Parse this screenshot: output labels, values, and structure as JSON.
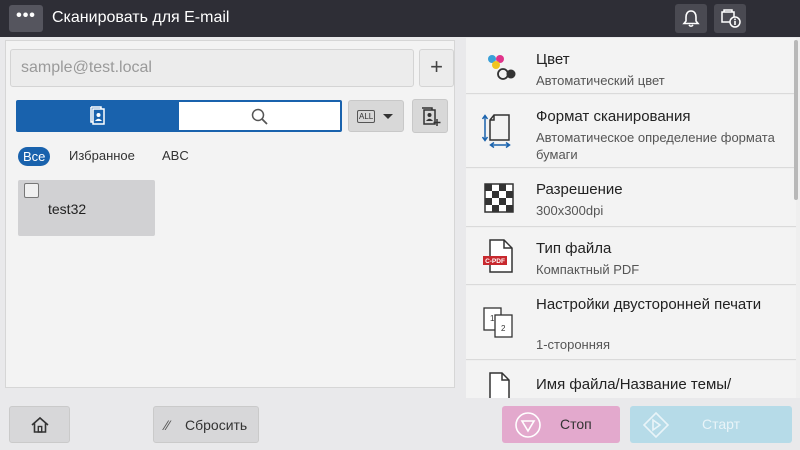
{
  "header": {
    "menu_label": "•••",
    "title": "Сканировать для E-mail",
    "icons": [
      "bell-icon",
      "info-status-icon"
    ]
  },
  "destination": {
    "email_placeholder": "sample@test.local",
    "add_label": "+"
  },
  "search_tabs": [
    "address-book-icon",
    "search-icon"
  ],
  "index_select": {
    "label": "ALL"
  },
  "filters": [
    "Все",
    "Избранное",
    "ABC"
  ],
  "active_filter": "Все",
  "address_entries": [
    {
      "name": "test32",
      "checked": false
    }
  ],
  "settings": [
    {
      "label": "Цвет",
      "value": "Автоматический цвет",
      "icon": "color-icon"
    },
    {
      "label": "Формат сканирования",
      "value": "Автоматическое определение формата бумаги",
      "icon": "scan-size-icon"
    },
    {
      "label": "Разрешение",
      "value": "300x300dpi",
      "icon": "resolution-icon"
    },
    {
      "label": "Тип файла",
      "value": "Компактный PDF",
      "icon": "compact-pdf-icon",
      "icon_text": "C-PDF"
    },
    {
      "label": "Настройки двусторонней печати",
      "value": "1-сторонняя",
      "icon": "duplex-icon"
    },
    {
      "label": "Имя файла/Название темы/Другое",
      "value": "",
      "icon": "document-icon"
    }
  ],
  "footer": {
    "reset_label": "Сбросить",
    "stop_label": "Стоп",
    "start_label": "Старт"
  },
  "colors": {
    "accent": "#1962ad",
    "topbar": "#2e2e36",
    "stop": "#e3a9cd",
    "start": "#b6dbe8"
  }
}
